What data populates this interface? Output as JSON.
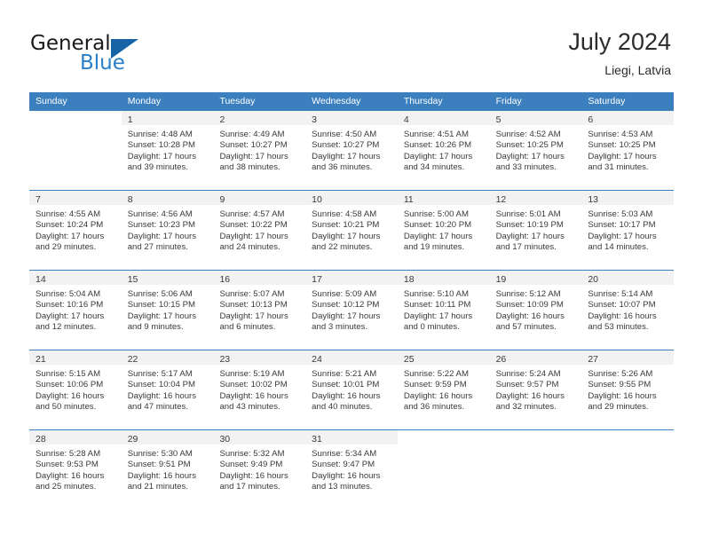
{
  "brand": {
    "name_part1": "General",
    "name_part2": "Blue",
    "flag_icon": "triangle-flag-icon"
  },
  "header": {
    "title": "July 2024",
    "subtitle": "Liegi, Latvia"
  },
  "colors": {
    "header_blue": "#3c7fbe",
    "brand_blue": "#2a7fc9",
    "flag_blue": "#1763a5",
    "day_band": "#f2f2f2",
    "text": "#3a3a3a"
  },
  "weekdays": [
    "Sunday",
    "Monday",
    "Tuesday",
    "Wednesday",
    "Thursday",
    "Friday",
    "Saturday"
  ],
  "weeks": [
    [
      {
        "num": "",
        "sunrise": "",
        "sunset": "",
        "daylight1": "",
        "daylight2": "",
        "empty": true
      },
      {
        "num": "1",
        "sunrise": "Sunrise: 4:48 AM",
        "sunset": "Sunset: 10:28 PM",
        "daylight1": "Daylight: 17 hours",
        "daylight2": "and 39 minutes.",
        "empty": false
      },
      {
        "num": "2",
        "sunrise": "Sunrise: 4:49 AM",
        "sunset": "Sunset: 10:27 PM",
        "daylight1": "Daylight: 17 hours",
        "daylight2": "and 38 minutes.",
        "empty": false
      },
      {
        "num": "3",
        "sunrise": "Sunrise: 4:50 AM",
        "sunset": "Sunset: 10:27 PM",
        "daylight1": "Daylight: 17 hours",
        "daylight2": "and 36 minutes.",
        "empty": false
      },
      {
        "num": "4",
        "sunrise": "Sunrise: 4:51 AM",
        "sunset": "Sunset: 10:26 PM",
        "daylight1": "Daylight: 17 hours",
        "daylight2": "and 34 minutes.",
        "empty": false
      },
      {
        "num": "5",
        "sunrise": "Sunrise: 4:52 AM",
        "sunset": "Sunset: 10:25 PM",
        "daylight1": "Daylight: 17 hours",
        "daylight2": "and 33 minutes.",
        "empty": false
      },
      {
        "num": "6",
        "sunrise": "Sunrise: 4:53 AM",
        "sunset": "Sunset: 10:25 PM",
        "daylight1": "Daylight: 17 hours",
        "daylight2": "and 31 minutes.",
        "empty": false
      }
    ],
    [
      {
        "num": "7",
        "sunrise": "Sunrise: 4:55 AM",
        "sunset": "Sunset: 10:24 PM",
        "daylight1": "Daylight: 17 hours",
        "daylight2": "and 29 minutes.",
        "empty": false
      },
      {
        "num": "8",
        "sunrise": "Sunrise: 4:56 AM",
        "sunset": "Sunset: 10:23 PM",
        "daylight1": "Daylight: 17 hours",
        "daylight2": "and 27 minutes.",
        "empty": false
      },
      {
        "num": "9",
        "sunrise": "Sunrise: 4:57 AM",
        "sunset": "Sunset: 10:22 PM",
        "daylight1": "Daylight: 17 hours",
        "daylight2": "and 24 minutes.",
        "empty": false
      },
      {
        "num": "10",
        "sunrise": "Sunrise: 4:58 AM",
        "sunset": "Sunset: 10:21 PM",
        "daylight1": "Daylight: 17 hours",
        "daylight2": "and 22 minutes.",
        "empty": false
      },
      {
        "num": "11",
        "sunrise": "Sunrise: 5:00 AM",
        "sunset": "Sunset: 10:20 PM",
        "daylight1": "Daylight: 17 hours",
        "daylight2": "and 19 minutes.",
        "empty": false
      },
      {
        "num": "12",
        "sunrise": "Sunrise: 5:01 AM",
        "sunset": "Sunset: 10:19 PM",
        "daylight1": "Daylight: 17 hours",
        "daylight2": "and 17 minutes.",
        "empty": false
      },
      {
        "num": "13",
        "sunrise": "Sunrise: 5:03 AM",
        "sunset": "Sunset: 10:17 PM",
        "daylight1": "Daylight: 17 hours",
        "daylight2": "and 14 minutes.",
        "empty": false
      }
    ],
    [
      {
        "num": "14",
        "sunrise": "Sunrise: 5:04 AM",
        "sunset": "Sunset: 10:16 PM",
        "daylight1": "Daylight: 17 hours",
        "daylight2": "and 12 minutes.",
        "empty": false
      },
      {
        "num": "15",
        "sunrise": "Sunrise: 5:06 AM",
        "sunset": "Sunset: 10:15 PM",
        "daylight1": "Daylight: 17 hours",
        "daylight2": "and 9 minutes.",
        "empty": false
      },
      {
        "num": "16",
        "sunrise": "Sunrise: 5:07 AM",
        "sunset": "Sunset: 10:13 PM",
        "daylight1": "Daylight: 17 hours",
        "daylight2": "and 6 minutes.",
        "empty": false
      },
      {
        "num": "17",
        "sunrise": "Sunrise: 5:09 AM",
        "sunset": "Sunset: 10:12 PM",
        "daylight1": "Daylight: 17 hours",
        "daylight2": "and 3 minutes.",
        "empty": false
      },
      {
        "num": "18",
        "sunrise": "Sunrise: 5:10 AM",
        "sunset": "Sunset: 10:11 PM",
        "daylight1": "Daylight: 17 hours",
        "daylight2": "and 0 minutes.",
        "empty": false
      },
      {
        "num": "19",
        "sunrise": "Sunrise: 5:12 AM",
        "sunset": "Sunset: 10:09 PM",
        "daylight1": "Daylight: 16 hours",
        "daylight2": "and 57 minutes.",
        "empty": false
      },
      {
        "num": "20",
        "sunrise": "Sunrise: 5:14 AM",
        "sunset": "Sunset: 10:07 PM",
        "daylight1": "Daylight: 16 hours",
        "daylight2": "and 53 minutes.",
        "empty": false
      }
    ],
    [
      {
        "num": "21",
        "sunrise": "Sunrise: 5:15 AM",
        "sunset": "Sunset: 10:06 PM",
        "daylight1": "Daylight: 16 hours",
        "daylight2": "and 50 minutes.",
        "empty": false
      },
      {
        "num": "22",
        "sunrise": "Sunrise: 5:17 AM",
        "sunset": "Sunset: 10:04 PM",
        "daylight1": "Daylight: 16 hours",
        "daylight2": "and 47 minutes.",
        "empty": false
      },
      {
        "num": "23",
        "sunrise": "Sunrise: 5:19 AM",
        "sunset": "Sunset: 10:02 PM",
        "daylight1": "Daylight: 16 hours",
        "daylight2": "and 43 minutes.",
        "empty": false
      },
      {
        "num": "24",
        "sunrise": "Sunrise: 5:21 AM",
        "sunset": "Sunset: 10:01 PM",
        "daylight1": "Daylight: 16 hours",
        "daylight2": "and 40 minutes.",
        "empty": false
      },
      {
        "num": "25",
        "sunrise": "Sunrise: 5:22 AM",
        "sunset": "Sunset: 9:59 PM",
        "daylight1": "Daylight: 16 hours",
        "daylight2": "and 36 minutes.",
        "empty": false
      },
      {
        "num": "26",
        "sunrise": "Sunrise: 5:24 AM",
        "sunset": "Sunset: 9:57 PM",
        "daylight1": "Daylight: 16 hours",
        "daylight2": "and 32 minutes.",
        "empty": false
      },
      {
        "num": "27",
        "sunrise": "Sunrise: 5:26 AM",
        "sunset": "Sunset: 9:55 PM",
        "daylight1": "Daylight: 16 hours",
        "daylight2": "and 29 minutes.",
        "empty": false
      }
    ],
    [
      {
        "num": "28",
        "sunrise": "Sunrise: 5:28 AM",
        "sunset": "Sunset: 9:53 PM",
        "daylight1": "Daylight: 16 hours",
        "daylight2": "and 25 minutes.",
        "empty": false
      },
      {
        "num": "29",
        "sunrise": "Sunrise: 5:30 AM",
        "sunset": "Sunset: 9:51 PM",
        "daylight1": "Daylight: 16 hours",
        "daylight2": "and 21 minutes.",
        "empty": false
      },
      {
        "num": "30",
        "sunrise": "Sunrise: 5:32 AM",
        "sunset": "Sunset: 9:49 PM",
        "daylight1": "Daylight: 16 hours",
        "daylight2": "and 17 minutes.",
        "empty": false
      },
      {
        "num": "31",
        "sunrise": "Sunrise: 5:34 AM",
        "sunset": "Sunset: 9:47 PM",
        "daylight1": "Daylight: 16 hours",
        "daylight2": "and 13 minutes.",
        "empty": false
      },
      {
        "num": "",
        "sunrise": "",
        "sunset": "",
        "daylight1": "",
        "daylight2": "",
        "empty": true
      },
      {
        "num": "",
        "sunrise": "",
        "sunset": "",
        "daylight1": "",
        "daylight2": "",
        "empty": true
      },
      {
        "num": "",
        "sunrise": "",
        "sunset": "",
        "daylight1": "",
        "daylight2": "",
        "empty": true
      }
    ]
  ]
}
